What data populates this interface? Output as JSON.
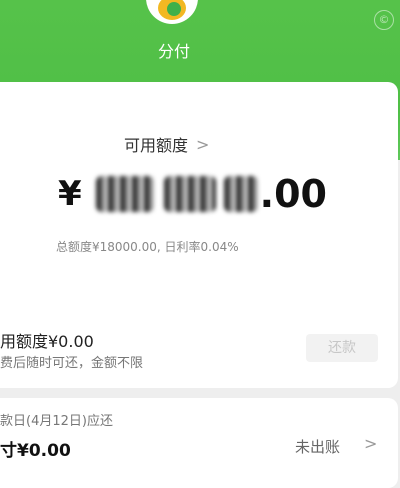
{
  "app": {
    "name": "分付",
    "logo": "fenfu-logo",
    "accent": "#4fbf46"
  },
  "credit": {
    "available_label": "可用额度",
    "currency": "¥",
    "amount_tail": ".00",
    "total_line": "总额度¥18000.00, 日利率0.04%"
  },
  "usage": {
    "used_label": "用额度¥0.00",
    "used_sub": "费后随时可还，金额不限",
    "repay_button": "还款"
  },
  "bill": {
    "due_label": "款日(4月12日)应还",
    "due_amount": "寸¥0.00",
    "status": "未出账"
  }
}
